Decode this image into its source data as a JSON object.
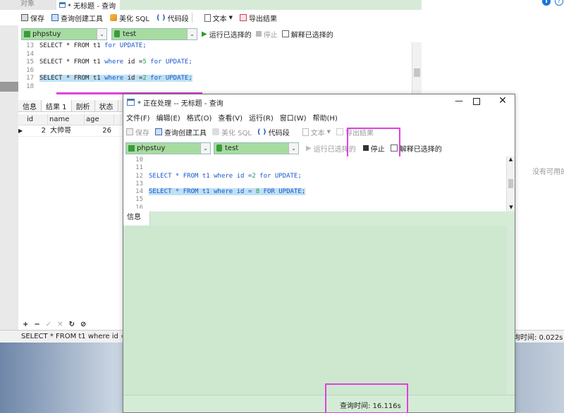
{
  "bg_window": {
    "tab_object": "对象",
    "tab_query": "* 无标题 - 查询",
    "toolbar": {
      "save": "保存",
      "query_builder": "查询创建工具",
      "beautify": "美化 SQL",
      "code_snippet": "代码段",
      "text": "文本",
      "export": "导出结果"
    },
    "conn": "phpstuy",
    "db": "test",
    "run_selected": "运行已选择的",
    "stop": "停止",
    "explain": "解释已选择的",
    "code": [
      {
        "ln": "13",
        "pre": "SELECT * FROM t1 ",
        "kw": "for UPDATE;",
        "num": "",
        "post": ""
      },
      {
        "ln": "14",
        "pre": "",
        "kw": "",
        "num": "",
        "post": ""
      },
      {
        "ln": "15",
        "pre": "SELECT * FROM t1 ",
        "kw": "where",
        "mid": " id =",
        "num": "5",
        "post": " for UPDATE;"
      },
      {
        "ln": "16",
        "pre": "",
        "kw": "",
        "num": "",
        "post": ""
      },
      {
        "ln": "17",
        "pre": "SELECT * FROM t1 ",
        "kw": "where",
        "mid": " id =",
        "num": "2",
        "post": " for UPDATE;"
      },
      {
        "ln": "18",
        "pre": "",
        "kw": "",
        "num": "",
        "post": ""
      }
    ],
    "result_tabs": [
      "信息",
      "结果 1",
      "剖析",
      "状态"
    ],
    "columns": [
      "id",
      "name",
      "age"
    ],
    "rows": [
      [
        "2",
        "大帅哥",
        "26"
      ]
    ],
    "status_sql": "SELECT * FROM t1 where id =2 f",
    "status_time": "询时间: 0.022s"
  },
  "right_panel": {
    "empty_text": "没有可用的"
  },
  "fg_window": {
    "title": "* 正在处理 -- 无标题 - 查询",
    "menu": [
      "文件(F)",
      "编辑(E)",
      "格式(O)",
      "查看(V)",
      "运行(R)",
      "窗口(W)",
      "帮助(H)"
    ],
    "toolbar": {
      "save": "保存",
      "query_builder": "查询创建工具",
      "beautify": "美化 SQL",
      "code_snippet": "代码段",
      "text": "文本",
      "export": "导出结果"
    },
    "conn": "phpstuy",
    "db": "test",
    "run_selected": "运行已选择的",
    "stop": "停止",
    "explain": "解释已选择的",
    "code": [
      {
        "ln": "10",
        "text": ""
      },
      {
        "ln": "11",
        "text": ""
      },
      {
        "ln": "12",
        "pre": "SELECT * FROM t1 ",
        "kw": "where",
        "mid": " id =",
        "num": "2",
        "post": " for UPDATE;"
      },
      {
        "ln": "13",
        "text": ""
      },
      {
        "ln": "14",
        "pre": "SELECT * FROM t1 ",
        "kw": "where",
        "mid": " id = ",
        "num": "8",
        "post": "  FOR UPDATE;"
      },
      {
        "ln": "15",
        "text": ""
      },
      {
        "ln": "16",
        "text": ""
      }
    ],
    "info_tab": "信息",
    "status_time": "查询时间: 16.116s"
  },
  "colors": {
    "accent_magenta": "#e040e0",
    "green_bg": "#cde8cf",
    "combo_green": "#a6dca0"
  }
}
